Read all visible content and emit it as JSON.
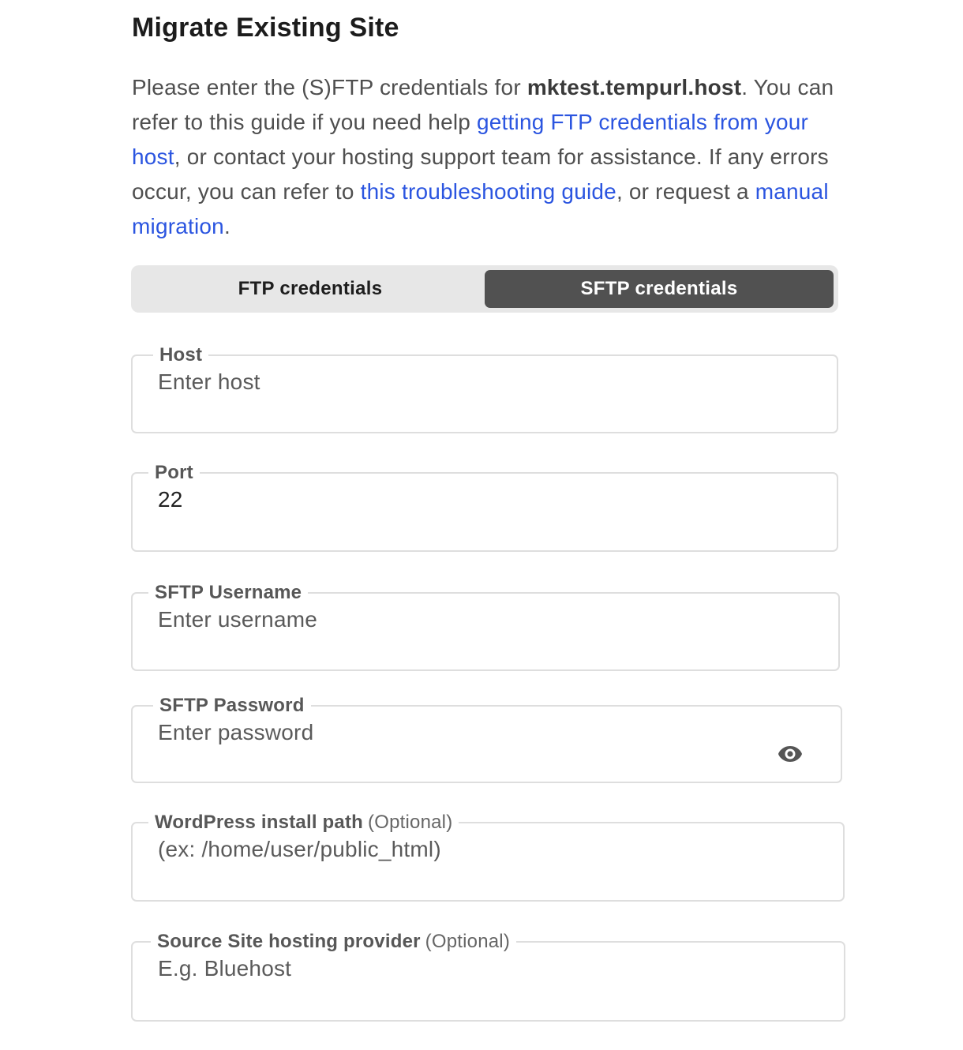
{
  "title": "Migrate Existing Site",
  "intro": {
    "t1": "Please enter the (S)FTP credentials for ",
    "domain": "mktest.tempurl.host",
    "t2": ". You can refer to this guide if you need help ",
    "link1": "getting FTP credentials from your host",
    "t3": ", or contact your hosting support team for assistance. If any errors occur, you can refer to ",
    "link2": "this troubleshooting guide",
    "t4": ", or request a ",
    "link3": "manual migration",
    "t5": "."
  },
  "tabs": {
    "ftp": "FTP credentials",
    "sftp": "SFTP credentials",
    "active": "sftp"
  },
  "fields": {
    "host": {
      "label": "Host",
      "placeholder": "Enter host",
      "value": ""
    },
    "port": {
      "label": "Port",
      "placeholder": "",
      "value": "22"
    },
    "username": {
      "label": "SFTP Username",
      "placeholder": "Enter username",
      "value": ""
    },
    "password": {
      "label": "SFTP Password",
      "placeholder": "Enter password",
      "value": "",
      "icon": "eye-icon"
    },
    "path": {
      "label": "WordPress install path",
      "optional": "(Optional)",
      "placeholder": "(ex: /home/user/public_html)",
      "value": ""
    },
    "provider": {
      "label": "Source Site hosting provider",
      "optional": "(Optional)",
      "placeholder": "E.g. Bluehost",
      "value": ""
    }
  },
  "colors": {
    "link": "#2b55e0",
    "active_tab": "#515151",
    "tab_bar": "#e7e7e7"
  }
}
